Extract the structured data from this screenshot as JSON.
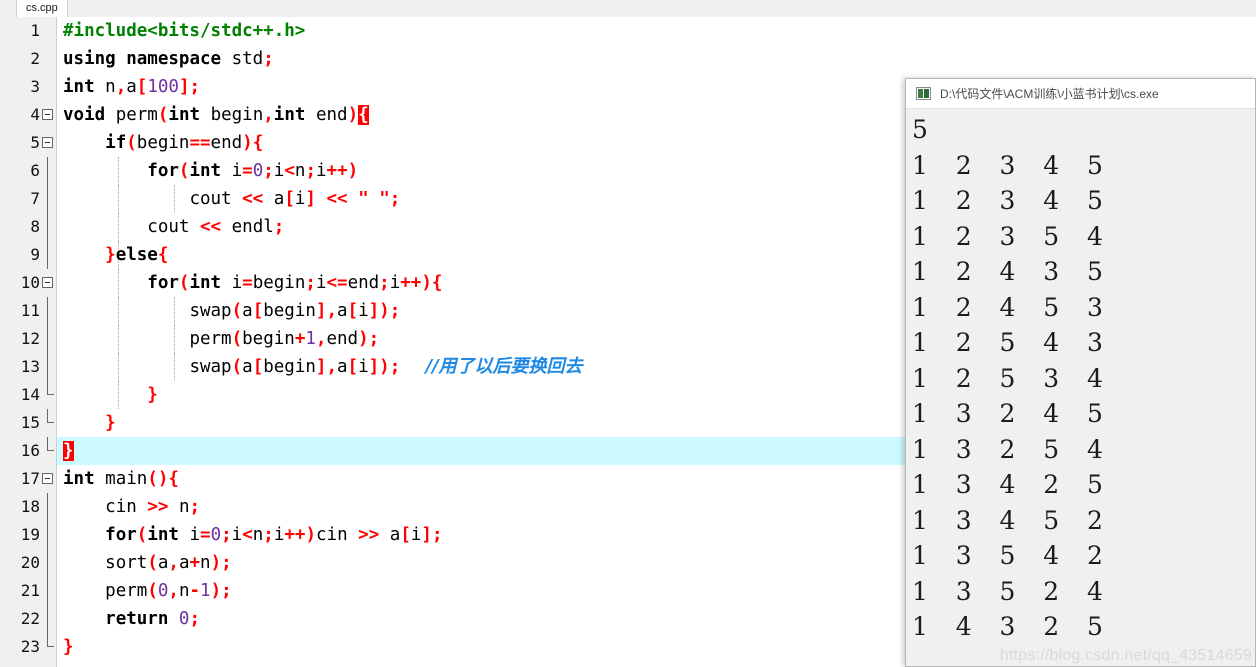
{
  "editor": {
    "tab": {
      "label": "cs.cpp"
    },
    "current_line": 16,
    "colors": {
      "preprocessor": "#008000",
      "keyword": "#000000",
      "punctuation": "#ff0000",
      "number": "#7030a0",
      "string": "#ff0000",
      "comment": "#1e88e5",
      "brace_match_bg": "#ff0000",
      "current_line_bg": "#ccfaff",
      "gutter_bg": "#f0f0f0",
      "editor_bg": "#ffffff"
    },
    "lines": [
      {
        "n": "1",
        "fold": "none",
        "indent": 0,
        "text": "#include<bits/stdc++.h>"
      },
      {
        "n": "2",
        "fold": "none",
        "indent": 0,
        "text": "using namespace std;"
      },
      {
        "n": "3",
        "fold": "none",
        "indent": 0,
        "text": "int n,a[100];"
      },
      {
        "n": "4",
        "fold": "open",
        "indent": 0,
        "text": "void perm(int begin,int end){"
      },
      {
        "n": "5",
        "fold": "open",
        "indent": 0,
        "text": "    if(begin==end){"
      },
      {
        "n": "6",
        "fold": "line",
        "indent": 1,
        "text": "        for(int i=0;i<n;i++)"
      },
      {
        "n": "7",
        "fold": "line",
        "indent": 2,
        "text": "            cout << a[i] << \" \";"
      },
      {
        "n": "8",
        "fold": "line",
        "indent": 1,
        "text": "        cout << endl;"
      },
      {
        "n": "9",
        "fold": "line",
        "indent": 1,
        "text": "    }else{"
      },
      {
        "n": "10",
        "fold": "open",
        "indent": 1,
        "text": "        for(int i=begin;i<=end;i++){"
      },
      {
        "n": "11",
        "fold": "line",
        "indent": 2,
        "text": "            swap(a[begin],a[i]);"
      },
      {
        "n": "12",
        "fold": "line",
        "indent": 2,
        "text": "            perm(begin+1,end);"
      },
      {
        "n": "13",
        "fold": "line",
        "indent": 2,
        "text": "            swap(a[begin],a[i]);",
        "comment": "//用了以后要换回去"
      },
      {
        "n": "14",
        "fold": "end",
        "indent": 1,
        "text": "        }"
      },
      {
        "n": "15",
        "fold": "end",
        "indent": 0,
        "text": "    }"
      },
      {
        "n": "16",
        "fold": "end",
        "indent": 0,
        "text": "}",
        "brace_match": true,
        "current": true
      },
      {
        "n": "17",
        "fold": "open",
        "indent": 0,
        "text": "int main(){"
      },
      {
        "n": "18",
        "fold": "line",
        "indent": 0,
        "text": "    cin >> n;"
      },
      {
        "n": "19",
        "fold": "line",
        "indent": 0,
        "text": "    for(int i=0;i<n;i++)cin >> a[i];"
      },
      {
        "n": "20",
        "fold": "line",
        "indent": 0,
        "text": "    sort(a,a+n);"
      },
      {
        "n": "21",
        "fold": "line",
        "indent": 0,
        "text": "    perm(0,n-1);"
      },
      {
        "n": "22",
        "fold": "line",
        "indent": 0,
        "text": "    return 0;"
      },
      {
        "n": "23",
        "fold": "end",
        "indent": 0,
        "text": "}"
      }
    ]
  },
  "console": {
    "title": "D:\\代码文件\\ACM训练\\小蓝书计划\\cs.exe",
    "icon": "console-app-icon",
    "output": [
      "5",
      "1 2 3 4 5",
      "1 2 3 4 5",
      "1 2 3 5 4",
      "1 2 4 3 5",
      "1 2 4 5 3",
      "1 2 5 4 3",
      "1 2 5 3 4",
      "1 3 2 4 5",
      "1 3 2 5 4",
      "1 3 4 2 5",
      "1 3 4 5 2",
      "1 3 5 4 2",
      "1 3 5 2 4",
      "1 4 3 2 5"
    ]
  },
  "watermark": {
    "text": "https://blog.csdn.net/qq_43514659"
  }
}
